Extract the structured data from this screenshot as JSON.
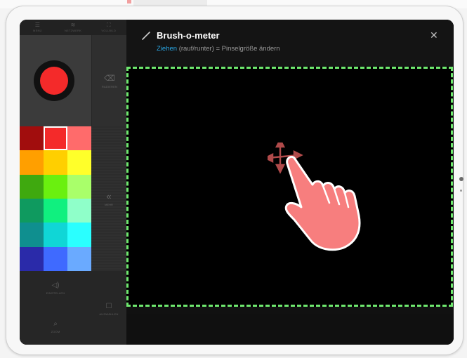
{
  "app": {
    "topbar": [
      {
        "icon": "☰",
        "label": "MENÜ"
      },
      {
        "icon": "≋",
        "label": "NETZWERK"
      },
      {
        "icon": "⛶",
        "label": "VOLLBILD"
      }
    ],
    "eraser": {
      "icon": "⌫",
      "label": "RADIEREN"
    },
    "more": {
      "icon": "«",
      "label": "MEHR"
    },
    "bottom_buttons": [
      {
        "icon": "◁)",
        "label": "EINSTELLEN"
      },
      {
        "icon": "☐",
        "label": "AUSWÄHLEN"
      },
      {
        "icon": "⌕",
        "label": "ZOOM"
      }
    ]
  },
  "palette": {
    "selected_index": 1,
    "colors": [
      "#a10d0d",
      "#f42a2a",
      "#ff6b6b",
      "#ff9f00",
      "#ffcf00",
      "#ffff2a",
      "#3fa90f",
      "#6af00f",
      "#a9ff6a",
      "#0f9a5f",
      "#10f07f",
      "#8fffc9",
      "#0f8f8f",
      "#10d6d6",
      "#2affff",
      "#2a2aa9",
      "#3f6aff",
      "#6aaaff"
    ]
  },
  "brush": {
    "color": "#f42a2a"
  },
  "dialog": {
    "title": "Brush-o-meter",
    "hint_action": "Ziehen",
    "hint_rest": "(rauf/runter) = Pinselgröße ändern"
  },
  "colors": {
    "accent_blue": "#2aa8e6",
    "dashed_border": "#6ee86e",
    "hand": "#f77e7e"
  }
}
